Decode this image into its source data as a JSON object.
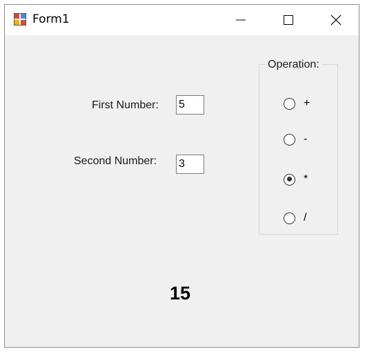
{
  "window": {
    "title": "Form1"
  },
  "titlebar": {
    "icons": {
      "app": "app-form-icon",
      "minimize": "minimize-icon",
      "maximize": "maximize-icon",
      "close": "close-icon"
    }
  },
  "form": {
    "first_number_label": "First Number:",
    "first_number_value": "5",
    "second_number_label": "Second Number:",
    "second_number_value": "3"
  },
  "operation": {
    "legend": "Operation:",
    "options": [
      {
        "label": "+",
        "checked": false
      },
      {
        "label": "-",
        "checked": false
      },
      {
        "label": "*",
        "checked": true
      },
      {
        "label": "/",
        "checked": false
      }
    ]
  },
  "result": {
    "value": "15"
  },
  "colors": {
    "form_background": "#f0f0f0",
    "titlebar_background": "#ffffff",
    "border": "#8c8c8c"
  }
}
